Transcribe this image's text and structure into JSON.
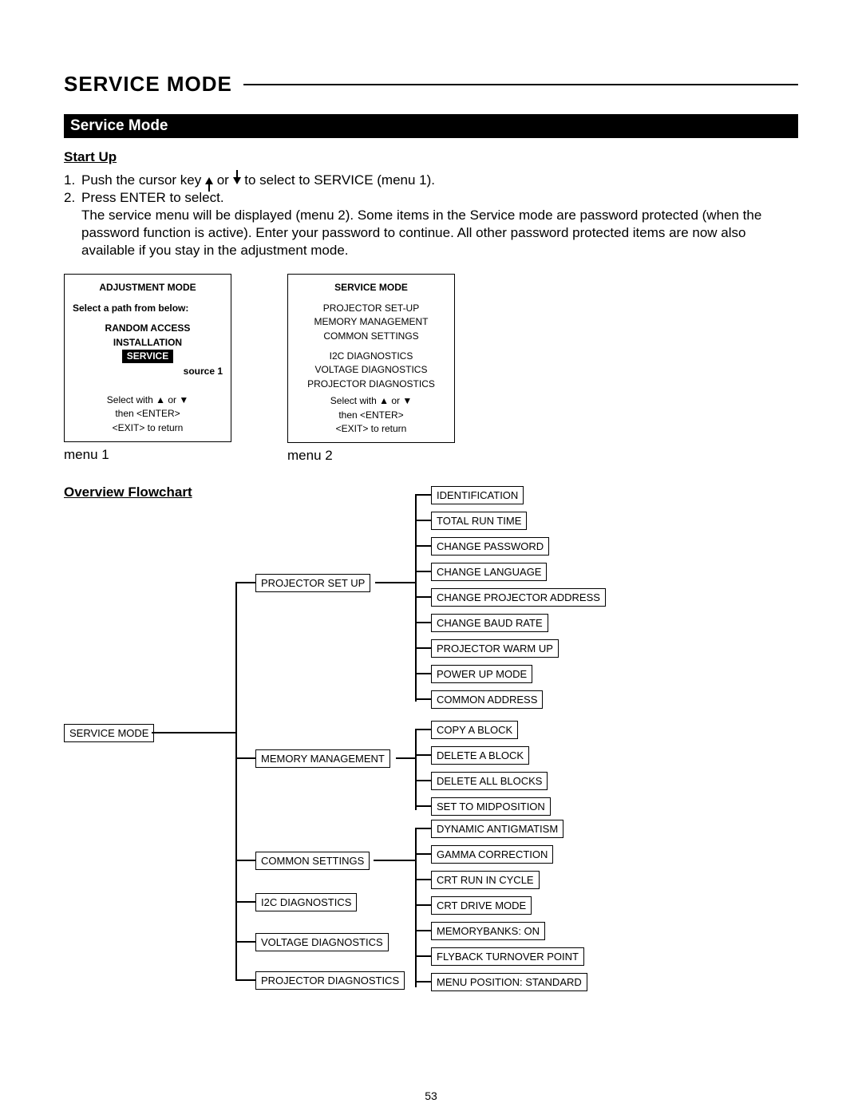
{
  "page_title": "SERVICE MODE",
  "section_bar": "Service Mode",
  "startup_head": "Start Up",
  "instructions": {
    "line1_prefix": "1.",
    "line1_a": "Push the cursor key ",
    "line1_mid": " or ",
    "line1_b": " to select to SERVICE (menu 1).",
    "line2_prefix": "2.",
    "line2": "Press ENTER to select.",
    "line2b": "The service menu will be displayed (menu 2). Some items in the Service mode are password protected (when the password function is active). Enter your password to continue. All other password protected items are now also available if you stay in the adjustment mode."
  },
  "menu1": {
    "title": "ADJUSTMENT MODE",
    "prompt": "Select a path from below:",
    "opt_random": "RANDOM ACCESS",
    "opt_install": "INSTALLATION",
    "opt_service": "SERVICE",
    "source": "source 1",
    "hint1": "Select with  ▲  or  ▼",
    "hint2": "then <ENTER>",
    "hint3": "<EXIT> to return",
    "caption": "menu 1"
  },
  "menu2": {
    "title": "SERVICE MODE",
    "l1": "PROJECTOR SET-UP",
    "l2": "MEMORY MANAGEMENT",
    "l3": "COMMON SETTINGS",
    "l4": "I2C DIAGNOSTICS",
    "l5": "VOLTAGE DIAGNOSTICS",
    "l6": "PROJECTOR DIAGNOSTICS",
    "hint1": "Select with  ▲  or  ▼",
    "hint2": "then <ENTER>",
    "hint3": "<EXIT> to return",
    "caption": "menu 2"
  },
  "flow_head": "Overview Flowchart",
  "flow": {
    "root": "SERVICE MODE",
    "b1": "PROJECTOR SET UP",
    "b2": "MEMORY MANAGEMENT",
    "b3": "COMMON SETTINGS",
    "b4": "I2C DIAGNOSTICS",
    "b5": "VOLTAGE DIAGNOSTICS",
    "b6": "PROJECTOR DIAGNOSTICS",
    "c1": "IDENTIFICATION",
    "c2": "TOTAL RUN TIME",
    "c3": "CHANGE PASSWORD",
    "c4": "CHANGE LANGUAGE",
    "c5": "CHANGE PROJECTOR ADDRESS",
    "c6": "CHANGE BAUD RATE",
    "c7": "PROJECTOR WARM UP",
    "c8": "POWER UP MODE",
    "c9": "COMMON ADDRESS",
    "d1": "COPY A BLOCK",
    "d2": "DELETE A BLOCK",
    "d3": "DELETE ALL BLOCKS",
    "d4": "SET TO MIDPOSITION",
    "e1": "DYNAMIC ANTIGMATISM",
    "e2": "GAMMA CORRECTION",
    "e3": "CRT RUN IN CYCLE",
    "e4": "CRT DRIVE MODE",
    "e5": "MEMORYBANKS: ON",
    "e6": "FLYBACK TURNOVER POINT",
    "e7": "MENU POSITION: STANDARD"
  },
  "page_number": "53"
}
